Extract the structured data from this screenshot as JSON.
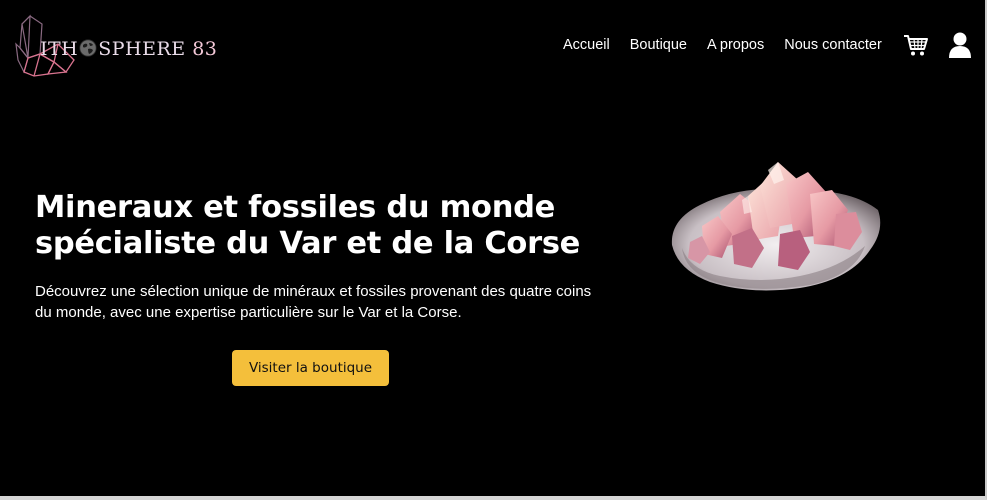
{
  "brand": {
    "logo_part1": "ITH",
    "logo_part2": "SPHERE",
    "logo_number": "83",
    "logo_icon": "crystal-icon",
    "globe_icon": "globe-icon"
  },
  "nav": {
    "items": [
      "Accueil",
      "Boutique",
      "A propos",
      "Nous contacter"
    ],
    "cart_icon": "cart-icon",
    "user_icon": "user-icon"
  },
  "hero": {
    "title_line1": "Mineraux et fossiles du monde",
    "title_line2": "spécialiste du Var et de la Corse",
    "description": "Découvrez une sélection unique de minéraux et fossiles provenant des quatre coins du monde, avec une expertise particulière sur le Var et la Corse.",
    "cta_label": "Visiter la boutique",
    "image": "pink-crystal-cluster"
  },
  "colors": {
    "background": "#000000",
    "accent": "#f4bf3b",
    "text": "#ffffff",
    "logo_pink": "#f4c9d8"
  }
}
